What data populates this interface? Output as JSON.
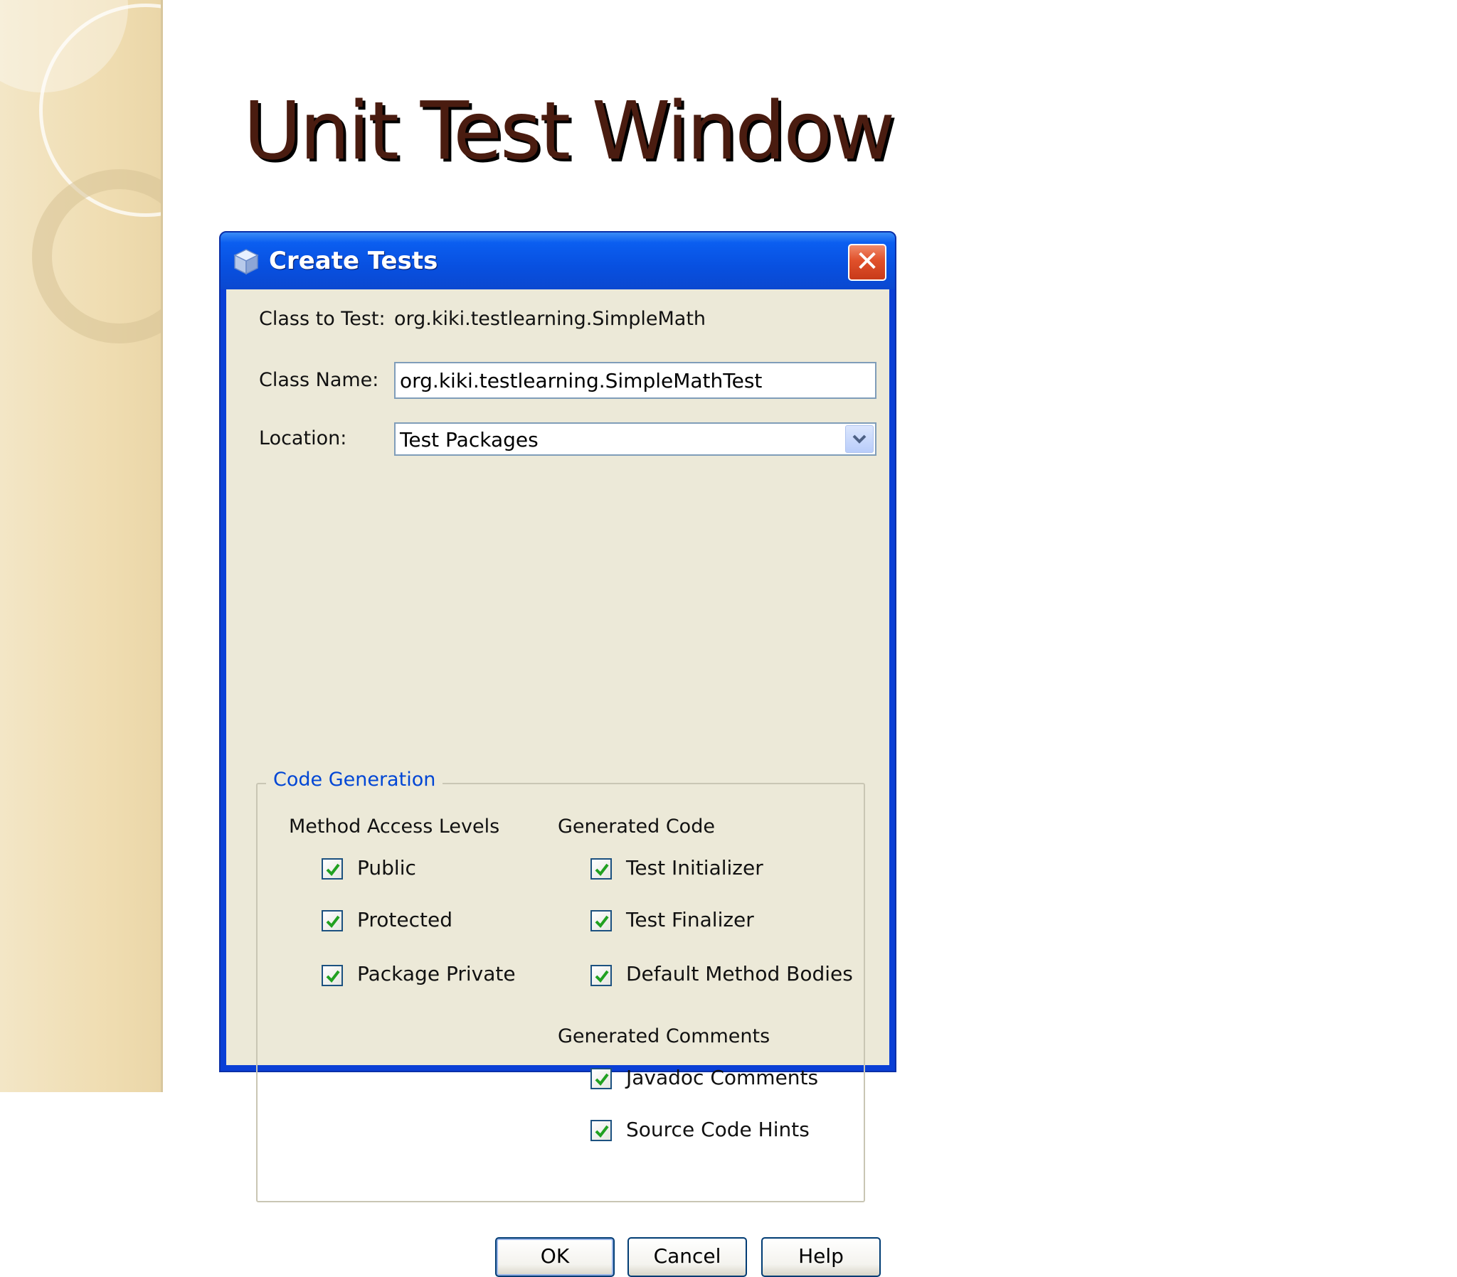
{
  "slide": {
    "title": "Unit Test Window"
  },
  "dialog": {
    "title": "Create Tests",
    "close_label": "✕",
    "class_to_test_label": "Class to Test:",
    "class_to_test_value": "org.kiki.testlearning.SimpleMath",
    "class_name_label": "Class Name:",
    "class_name_value": "org.kiki.testlearning.SimpleMathTest",
    "location_label": "Location:",
    "location_value": "Test Packages",
    "code_generation": {
      "legend": "Code Generation",
      "method_access_levels": {
        "heading": "Method Access Levels",
        "items": [
          {
            "label": "Public",
            "checked": true
          },
          {
            "label": "Protected",
            "checked": true
          },
          {
            "label": "Package Private",
            "checked": true
          }
        ]
      },
      "generated_code": {
        "heading": "Generated Code",
        "items": [
          {
            "label": "Test Initializer",
            "checked": true
          },
          {
            "label": "Test Finalizer",
            "checked": true
          },
          {
            "label": "Default Method Bodies",
            "checked": true
          }
        ]
      },
      "generated_comments": {
        "heading": "Generated Comments",
        "items": [
          {
            "label": "Javadoc Comments",
            "checked": true
          },
          {
            "label": "Source Code Hints",
            "checked": true
          }
        ]
      }
    },
    "buttons": {
      "ok": "OK",
      "cancel": "Cancel",
      "help": "Help"
    }
  },
  "colors": {
    "title_text": "#4a1c10",
    "titlebar": "#0850e0",
    "dialog_face": "#ece9d8",
    "legend_text": "#0046d5",
    "check_mark": "#21a121"
  }
}
